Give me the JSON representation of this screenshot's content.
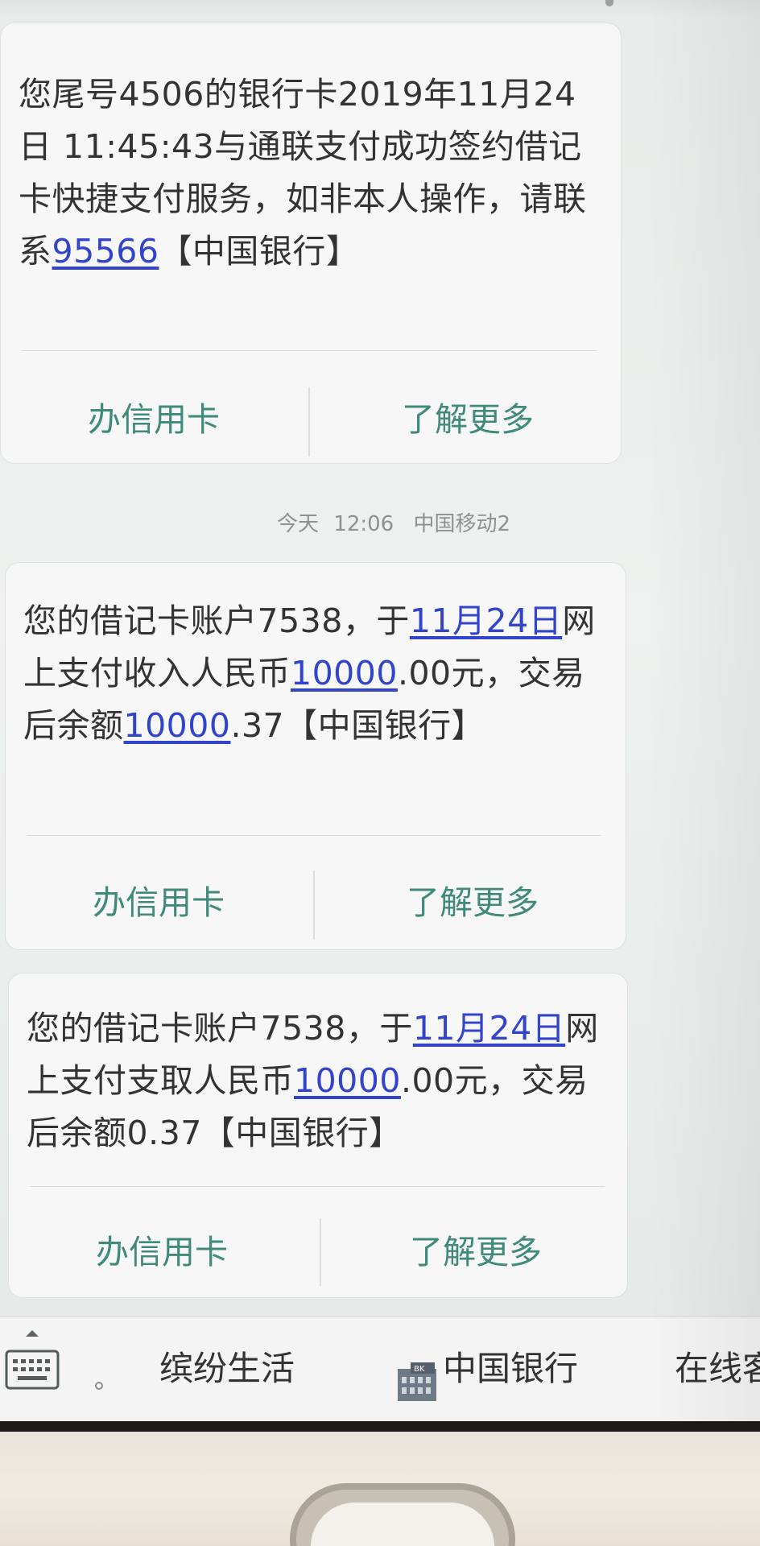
{
  "messages": [
    {
      "text_1": "您尾号4506的银行卡2019年11月24日 11:45:43与通联支付成功签约借记卡快捷支付服务，如非本人操作，请联系",
      "link_1": "95566",
      "text_2": "【中国银行】",
      "action_left": "办信用卡",
      "action_right": "了解更多"
    },
    {
      "text_1": "您的借记卡账户7538，于",
      "link_1": "11月24日",
      "text_2": "网上支付收入人民币",
      "link_2": "10000",
      "text_3": ".00元，交易后余额",
      "link_3": "10000",
      "text_4": ".37【中国银行】",
      "action_left": "办信用卡",
      "action_right": "了解更多"
    },
    {
      "text_1": "您的借记卡账户7538，于",
      "link_1": "11月24日",
      "text_2": "网上支付支取人民币",
      "link_2": "10000",
      "text_3": ".00元，交易后余额0.37【中国银行】",
      "action_left": "办信用卡",
      "action_right": "了解更多"
    }
  ],
  "timestamp": {
    "day": "今天",
    "time": "12:06",
    "carrier": "中国移动2"
  },
  "menu": {
    "items": [
      "缤纷生活",
      "中国银行",
      "在线客"
    ]
  },
  "icons": {
    "keyboard": "keyboard-icon",
    "bank": "bank-icon",
    "expand": "caret-up-icon"
  },
  "colors": {
    "link": "#3344cc",
    "action": "#3f8a79",
    "bubble": "#f6f7f6"
  }
}
